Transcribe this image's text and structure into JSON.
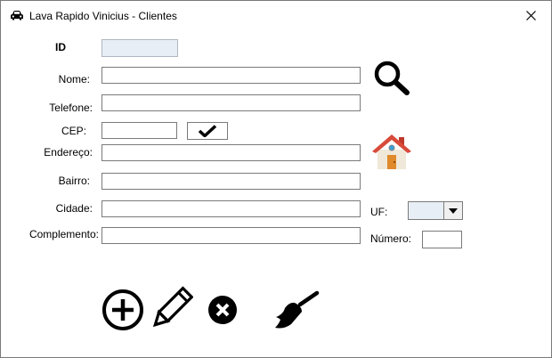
{
  "window": {
    "title": "Lava Rapido Vinicius - Clientes"
  },
  "labels": {
    "id": "ID",
    "nome": "Nome:",
    "telefone": "Telefone:",
    "cep": "CEP:",
    "endereco": "Endereço:",
    "bairro": "Bairro:",
    "cidade": "Cidade:",
    "complemento": "Complemento:",
    "uf": "UF:",
    "numero": "Número:"
  },
  "fields": {
    "id": "",
    "nome": "",
    "telefone": "",
    "cep": "",
    "endereco": "",
    "bairro": "",
    "cidade": "",
    "complemento": "",
    "uf": "",
    "numero": ""
  },
  "icons": {
    "title": "car-icon",
    "close": "close-icon",
    "search": "search-icon",
    "check": "check-icon",
    "home": "home-icon",
    "add": "add-circle-icon",
    "edit": "pencil-icon",
    "delete": "delete-circle-icon",
    "clear": "broom-icon",
    "dropdown": "dropdown-arrow-icon"
  }
}
